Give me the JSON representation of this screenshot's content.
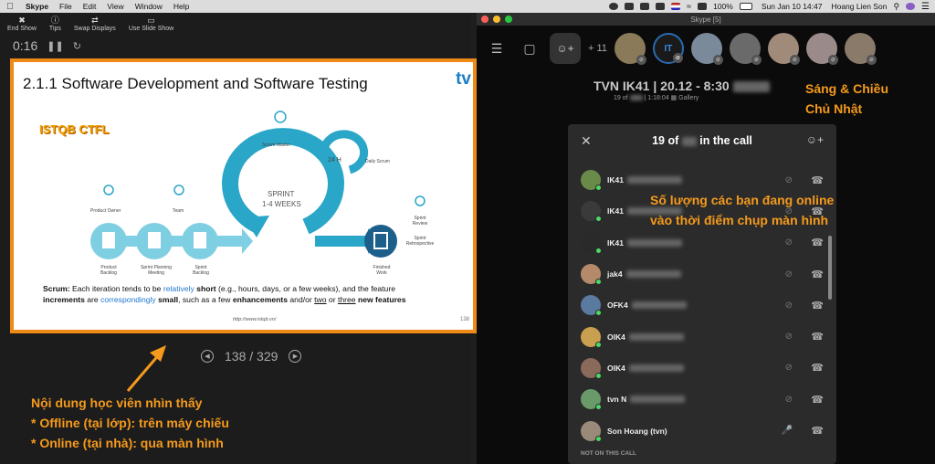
{
  "menubar": {
    "app_name": "Skype",
    "items": [
      "File",
      "Edit",
      "View",
      "Window",
      "Help"
    ],
    "battery": "100%",
    "clock": "Sun Jan 10  14:47",
    "user": "Hoang Lien Son"
  },
  "presenter": {
    "toolbar": [
      {
        "label": "End Show",
        "icon": "end-show-icon"
      },
      {
        "label": "Tips",
        "icon": "info-icon"
      },
      {
        "label": "Swap Displays",
        "icon": "swap-icon"
      },
      {
        "label": "Use Slide Show",
        "icon": "slideshow-icon"
      }
    ],
    "timer": "0:16",
    "page_indicator": "138 / 329"
  },
  "slide": {
    "title": "2.1.1 Software Development and Software Testing",
    "logo": "tv",
    "stamp": "ISTQB CTFL",
    "labels": {
      "scrum_master": "Scrum Master",
      "daily_scrum": "Daily Scrum",
      "hours": "24 H",
      "sprint": "SPRINT",
      "weeks": "1-4 WEEKS",
      "product_owner": "Product Owner",
      "team": "Team",
      "product_backlog": "Product Backlog",
      "sprint_planning": "Sprint Planning Meeting",
      "sprint_backlog": "Sprint Backlog",
      "finished_work": "Finished Work",
      "sprint_review": "Sprint Review",
      "sprint_retro": "Sprint Retrospective"
    },
    "text": {
      "p1": "Scrum:",
      "p2": " Each iteration tends to be ",
      "p3": "relatively",
      "p4": " short",
      "p5": " (e.g., hours, days, or a few weeks), and the feature",
      "p6": "increments",
      "p7": " are ",
      "p8": "correspondingly",
      "p9": " small",
      "p10": ", such as a few ",
      "p11": "enhancements",
      "p12": " and/or ",
      "p13": "two",
      "p14": " or ",
      "p15": "three",
      "p16": " new features"
    },
    "url": "http://www.istqb.vn/",
    "number": "138"
  },
  "annotations": {
    "left": [
      "Nội dung học viên nhìn thấy",
      "* Offline (tại lớp): trên máy chiếu",
      "* Online (tại nhà): qua màn hình"
    ],
    "time": [
      "Sáng & Chiều",
      "Chủ Nhật"
    ],
    "online": [
      "Số lượng các bạn đang online",
      "vào thời điểm chụp màn hình"
    ]
  },
  "skype": {
    "window_title": "Skype [5]",
    "more_count": "+ 11",
    "meeting_title": "TVN IK41 | 20.12 - 8:30",
    "meeting_sub": "19 of",
    "meeting_sub_time": "| 1:18:04",
    "gallery": "Gallery",
    "panel": {
      "count_prefix": "19 of",
      "count_suffix": "in the call",
      "participants": [
        {
          "name": "IK41",
          "color": "#6a8a4a",
          "muted": true
        },
        {
          "name": "IK41",
          "color": "#3a3a3a",
          "muted": true
        },
        {
          "name": "IK41",
          "color": "#2a2a2a",
          "muted": true
        },
        {
          "name": "jak4",
          "color": "#b58a6a",
          "muted": true
        },
        {
          "name": "OFK4",
          "color": "#5a7aa0",
          "muted": true
        },
        {
          "name": "OIK4",
          "color": "#c8a050",
          "muted": true
        },
        {
          "name": "OIK4",
          "color": "#8a6a5a",
          "muted": true
        },
        {
          "name": "tvn N",
          "color": "#6a9a6a",
          "muted": true
        },
        {
          "name": "Son Hoang (tvn)",
          "color": "#9a8a7a",
          "muted": false
        }
      ],
      "not_on_call": "NOT ON THIS CALL"
    }
  },
  "colors": {
    "accent": "#f59a1c",
    "slide_border": "#f08a16",
    "online": "#4cd964",
    "teal": "#2aa6c8"
  }
}
